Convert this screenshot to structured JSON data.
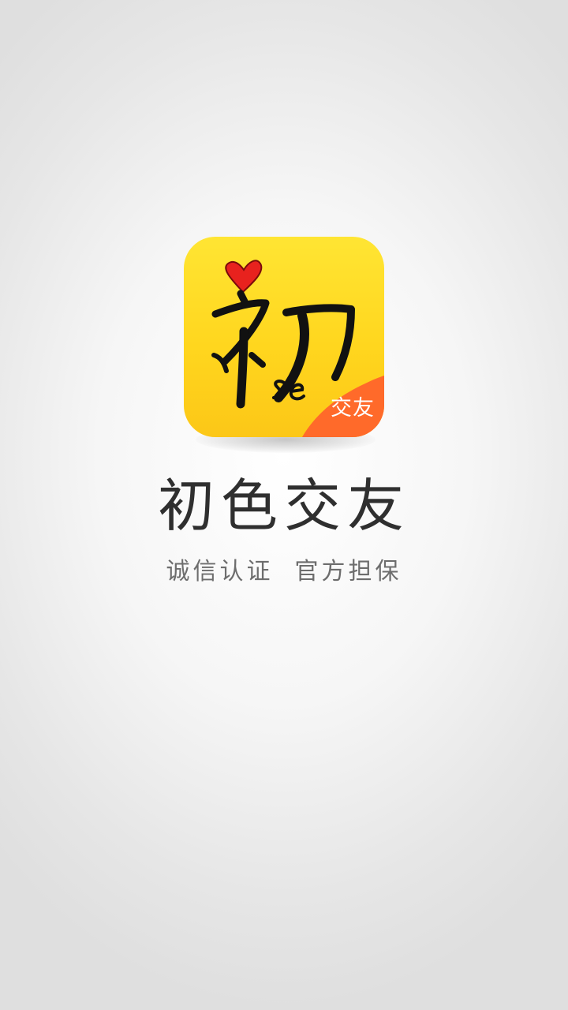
{
  "splash": {
    "logo": {
      "glyph": "初",
      "latin": "se",
      "badge": "交友",
      "icon": "heart-icon",
      "colors": {
        "tile": "#ffd61e",
        "badge": "#ff6a2a",
        "heart": "#e8221e",
        "ink": "#111111"
      }
    },
    "app_name": "初色交友",
    "slogan": "诚信认证  官方担保"
  }
}
